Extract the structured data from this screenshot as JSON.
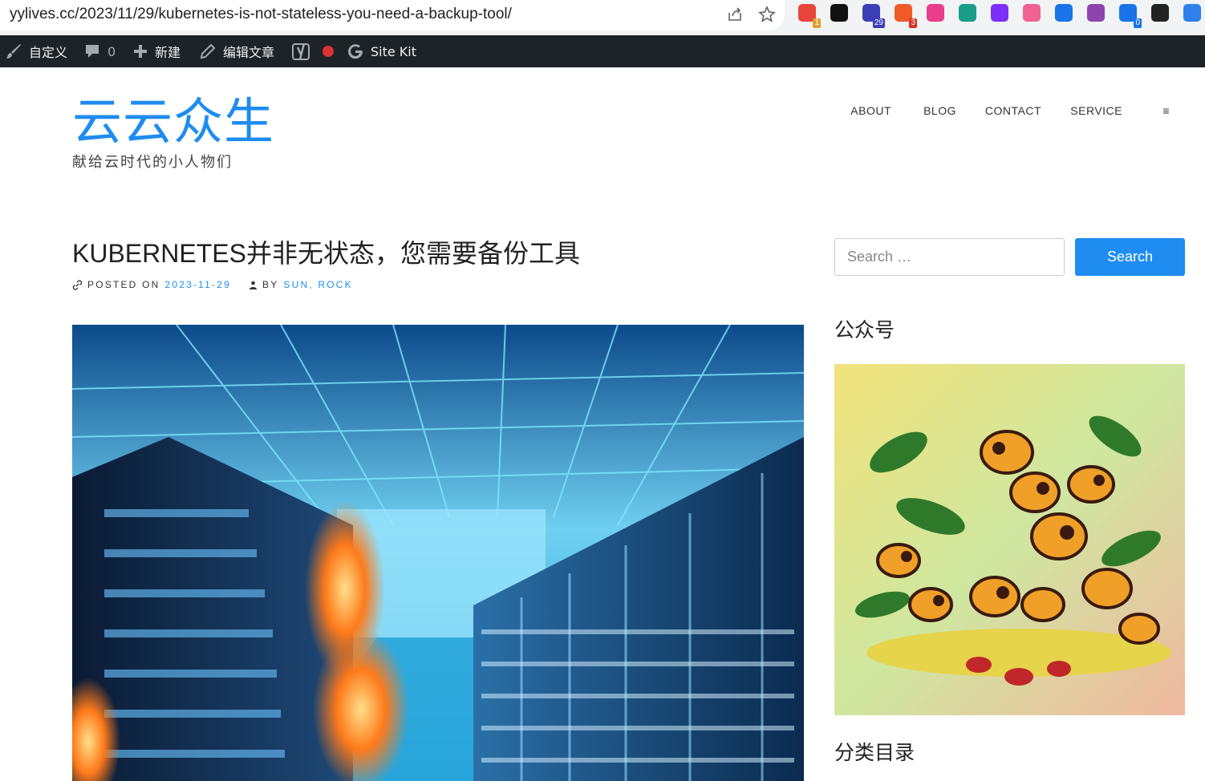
{
  "browser": {
    "url": "yylives.cc/2023/11/29/kubernetes-is-not-stateless-you-need-a-backup-tool/",
    "extensions": [
      {
        "name": "chrome-ext-1-icon",
        "badge": "1",
        "color": "#e8453c"
      },
      {
        "name": "notion-icon",
        "badge": "",
        "color": "#111111"
      },
      {
        "name": "graduation-cap-icon",
        "badge": "29",
        "color": "#3b3fb6"
      },
      {
        "name": "ext-orange-icon",
        "badge": "3",
        "color": "#f05a28"
      },
      {
        "name": "translate-icon",
        "badge": "",
        "color": "#e83e8c"
      },
      {
        "name": "ext-green-icon",
        "badge": "",
        "color": "#1a9c8a"
      },
      {
        "name": "ext-purple-icon",
        "badge": "",
        "color": "#7b2ff7"
      },
      {
        "name": "cloud-icon",
        "badge": "",
        "color": "#f06292"
      },
      {
        "name": "ext-blue-icon",
        "badge": "",
        "color": "#1a73e8"
      },
      {
        "name": "openai-icon",
        "badge": "",
        "color": "#8e44ad"
      },
      {
        "name": "ext-repeat-icon",
        "badge": "0",
        "color": "#1a73e8"
      },
      {
        "name": "ext-dark-icon",
        "badge": "",
        "color": "#222222"
      },
      {
        "name": "ext-blue-circle-icon",
        "badge": "",
        "color": "#2f80ed"
      }
    ]
  },
  "adminbar": {
    "customize": "自定义",
    "comments_count": "0",
    "new": "新建",
    "edit_post": "编辑文章",
    "site_kit": "Site Kit"
  },
  "site": {
    "title": "云云众生",
    "tagline": "献给云时代的小人物们",
    "accent": "#1e8cf0"
  },
  "nav": {
    "items": [
      "ABOUT",
      "BLOG",
      "CONTACT",
      "SERVICE",
      "≡"
    ]
  },
  "post": {
    "title": "KUBERNETES并非无状态，您需要备份工具",
    "posted_on_label": "POSTED ON",
    "date": "2023-11-29",
    "by_label": "BY",
    "author": "SUN, ROCK"
  },
  "sidebar": {
    "search_placeholder": "Search …",
    "search_button": "Search",
    "widget1_title": "公众号",
    "widget2_title": "分类目录"
  }
}
